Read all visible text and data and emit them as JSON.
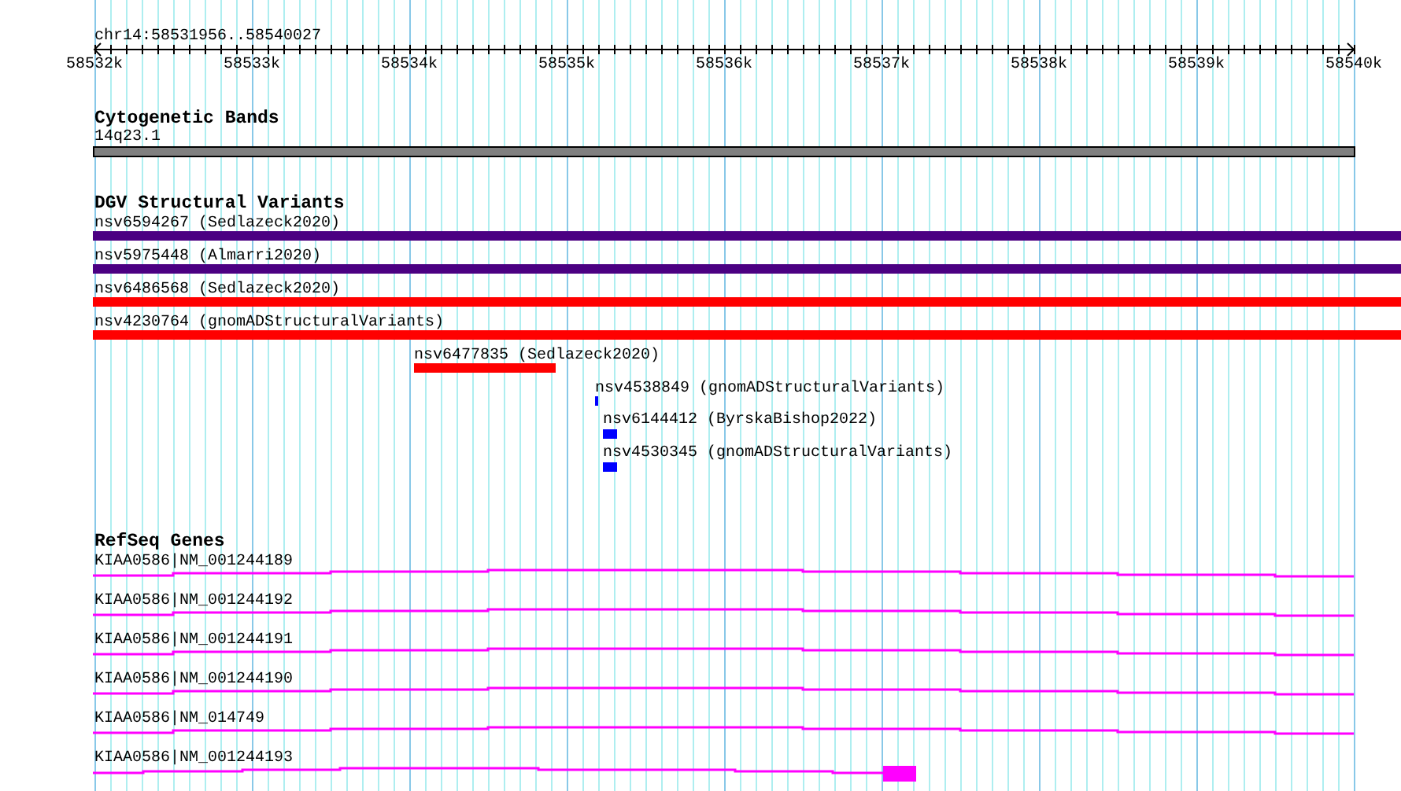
{
  "ruler": {
    "title": "chr14:58531956..58540027",
    "ticks": [
      "58532k",
      "58533k",
      "58534k",
      "58535k",
      "58536k",
      "58537k",
      "58538k",
      "58539k",
      "58540k"
    ]
  },
  "tracks": [
    {
      "title": "Cytogenetic Bands",
      "kind": "band",
      "features": [
        {
          "label": "14q23.1"
        }
      ]
    },
    {
      "title": "DGV Structural Variants",
      "kind": "variant",
      "features": [
        {
          "label": "nsv6594267 (Sedlazeck2020)",
          "color": "#4b0082"
        },
        {
          "label": "nsv5975448 (Almarri2020)",
          "color": "#4b0082"
        },
        {
          "label": "nsv6486568 (Sedlazeck2020)",
          "color": "#ff0000"
        },
        {
          "label": "nsv4230764 (gnomADStructuralVariants)",
          "color": "#ff0000"
        },
        {
          "label": "nsv6477835 (Sedlazeck2020)",
          "color": "#ff0000"
        },
        {
          "label": "nsv4538849 (gnomADStructuralVariants)",
          "color": "#0000ff"
        },
        {
          "label": "nsv6144412 (ByrskaBishop2022)",
          "color": "#0000ff"
        },
        {
          "label": "nsv4530345 (gnomADStructuralVariants)",
          "color": "#0000ff"
        }
      ]
    },
    {
      "title": "RefSeq Genes",
      "kind": "gene",
      "features": [
        {
          "label": "KIAA0586|NM_001244189"
        },
        {
          "label": "KIAA0586|NM_001244192"
        },
        {
          "label": "KIAA0586|NM_001244191"
        },
        {
          "label": "KIAA0586|NM_001244190"
        },
        {
          "label": "KIAA0586|NM_014749"
        },
        {
          "label": "KIAA0586|NM_001244193"
        }
      ]
    }
  ]
}
